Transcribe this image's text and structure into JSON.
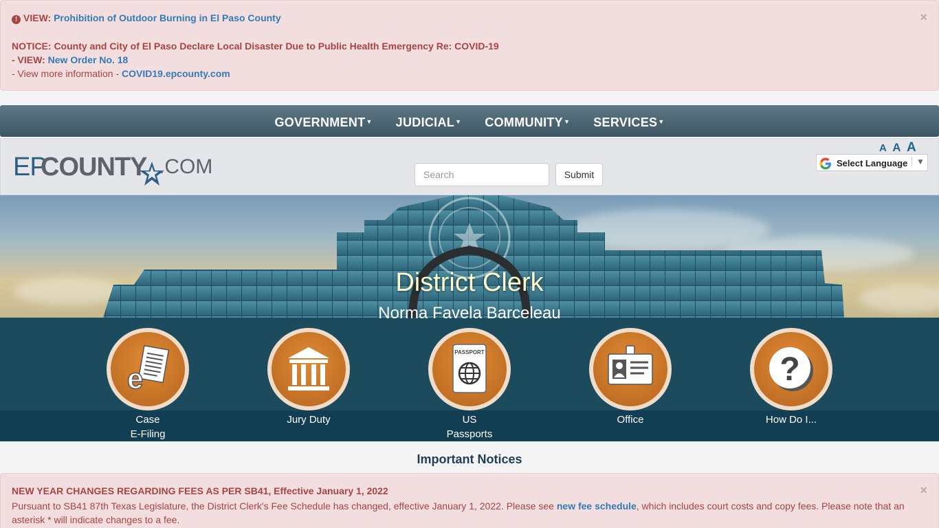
{
  "top_alert": {
    "line1_prefix": "VIEW:",
    "line1_link": "Prohibition of Outdoor Burning in El Paso County",
    "notice": "NOTICE: County and City of El Paso Declare Local Disaster Due to Public Health Emergency Re: COVID-19",
    "line3_prefix": "- VIEW:",
    "line3_link": "New Order No. 18",
    "line4_prefix": "- View more information -",
    "line4_link": "COVID19.epcounty.com",
    "close": "×"
  },
  "nav": {
    "items": [
      "GOVERNMENT",
      "JUDICIAL",
      "COMMUNITY",
      "SERVICES"
    ]
  },
  "header": {
    "logo_ep": "EP",
    "logo_county": "COUNTY",
    "logo_dotcom": ".COM",
    "search_placeholder": "Search",
    "submit_label": "Submit",
    "font_sizes": [
      "A",
      "A",
      "A"
    ],
    "language_label": "Select Language",
    "language_arrow": "▼"
  },
  "hero": {
    "title": "District Clerk",
    "subtitle": "Norma Favela Barceleau"
  },
  "tiles": [
    {
      "line1": "Case",
      "line2": "E-Filing",
      "icon": "efiling-icon"
    },
    {
      "line1": "Jury Duty",
      "line2": "",
      "icon": "courthouse-icon"
    },
    {
      "line1": "US",
      "line2": "Passports",
      "icon": "passport-icon"
    },
    {
      "line1": "Office",
      "line2": "",
      "icon": "id-badge-icon"
    },
    {
      "line1": "How Do I...",
      "line2": "",
      "icon": "question-icon"
    }
  ],
  "passport_text": "PASSPORT",
  "notices": {
    "heading": "Important Notices",
    "title": "NEW YEAR CHANGES REGARDING FEES AS PER SB41, Effective January 1, 2022",
    "body_before": "Pursuant to SB41 87th Texas Legislature, the District Clerk's Fee Schedule has changed, effective January 1, 2022. Please see ",
    "body_link": "new fee schedule",
    "body_after": ", which includes court costs and copy fees. Please note that an asterisk * will indicate changes to a fee.",
    "close": "×"
  },
  "colors": {
    "alert_bg": "#f2dede",
    "alert_text": "#a94442",
    "link": "#337ab7",
    "navbar": "#4a6472",
    "band": "#1d4b5e",
    "tile_orange": "#c9762a"
  }
}
